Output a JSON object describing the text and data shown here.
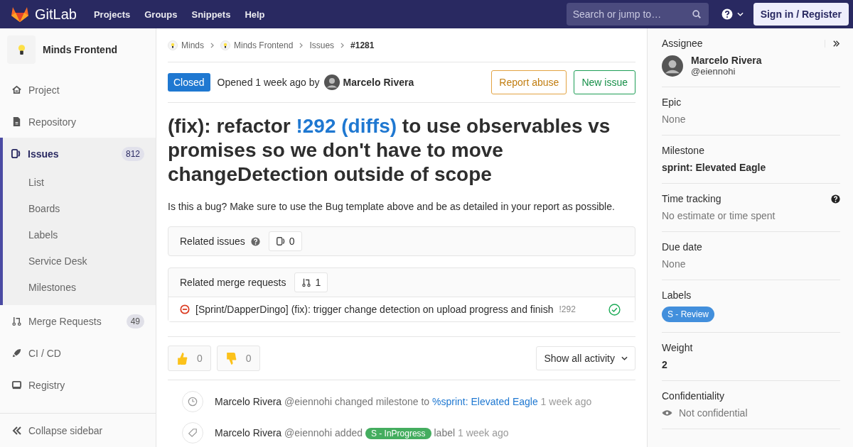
{
  "topbar": {
    "brand": "GitLab",
    "menu": [
      "Projects",
      "Groups",
      "Snippets",
      "Help"
    ],
    "search": {
      "placeholder": "Search or jump to…"
    },
    "sign_in": "Sign in / Register"
  },
  "sidebar": {
    "project": "Minds Frontend",
    "items": [
      {
        "label": "Project",
        "selected": false
      },
      {
        "label": "Repository",
        "selected": false
      },
      {
        "label": "Issues",
        "selected": true,
        "count": "812",
        "children": [
          {
            "label": "List"
          },
          {
            "label": "Boards"
          },
          {
            "label": "Labels"
          },
          {
            "label": "Service Desk"
          },
          {
            "label": "Milestones"
          }
        ]
      },
      {
        "label": "Merge Requests",
        "selected": false,
        "count": "49"
      },
      {
        "label": "CI / CD",
        "selected": false
      },
      {
        "label": "Registry",
        "selected": false
      }
    ],
    "collapse": "Collapse sidebar"
  },
  "breadcrumbs": [
    {
      "label": "Minds",
      "kind": "group"
    },
    {
      "label": "Minds Frontend",
      "kind": "group"
    },
    {
      "label": "Issues",
      "kind": "plain"
    },
    {
      "label": "#1281",
      "kind": "current"
    }
  ],
  "issue": {
    "status": "Closed",
    "opened": "Opened 1 week ago by",
    "author": "Marcelo Rivera",
    "actions": [
      {
        "label": "Report abuse",
        "kind": "warning"
      },
      {
        "label": "New issue",
        "kind": "success"
      }
    ],
    "title": [
      {
        "text": "(fix): refactor ",
        "link": false
      },
      {
        "text": "!292 (diffs)",
        "link": true
      },
      {
        "text": " to use observables vs promises so we don't have to move changeDetection outside of scope",
        "link": false
      }
    ],
    "description": "Is this a bug? Make sure to use the Bug template above and be as detailed in your report as possible."
  },
  "related_issues": {
    "title": "Related issues",
    "count": "0"
  },
  "related_merge_requests": {
    "title": "Related merge requests",
    "count": "1",
    "items": [
      {
        "title": "[Sprint/DapperDingo] (fix): trigger change detection on upload progress and finish",
        "ref": "!292"
      }
    ]
  },
  "awards": [
    {
      "kind": "thumbsup",
      "count": "0"
    },
    {
      "kind": "thumbsdown",
      "count": "0"
    }
  ],
  "activity_filter": "Show all activity",
  "events": [
    {
      "kind": "milestone",
      "author": "Marcelo Rivera",
      "handle": "@eiennohi",
      "action": "changed milestone to",
      "link": "%sprint: Elevated Eagle",
      "time": "1 week ago"
    },
    {
      "kind": "label",
      "author": "Marcelo Rivera",
      "handle": "@eiennohi",
      "action": "added",
      "label": "S - InProgress",
      "after": "label",
      "time": "1 week ago"
    }
  ],
  "right_sidebar": {
    "assignee": {
      "title": "Assignee",
      "name": "Marcelo Rivera",
      "handle": "@eiennohi"
    },
    "blocks": [
      {
        "kind": "muted",
        "title": "Epic",
        "value": "None"
      },
      {
        "kind": "bold",
        "title": "Milestone",
        "value": "sprint: Elevated Eagle"
      },
      {
        "kind": "help",
        "title": "Time tracking",
        "value": "No estimate or time spent"
      },
      {
        "kind": "muted",
        "title": "Due date",
        "value": "None"
      },
      {
        "kind": "label",
        "title": "Labels",
        "value": "S - Review",
        "color": "#428fdc"
      },
      {
        "kind": "bold",
        "title": "Weight",
        "value": "2"
      },
      {
        "kind": "eye",
        "title": "Confidentiality",
        "value": "Not confidential"
      }
    ]
  }
}
